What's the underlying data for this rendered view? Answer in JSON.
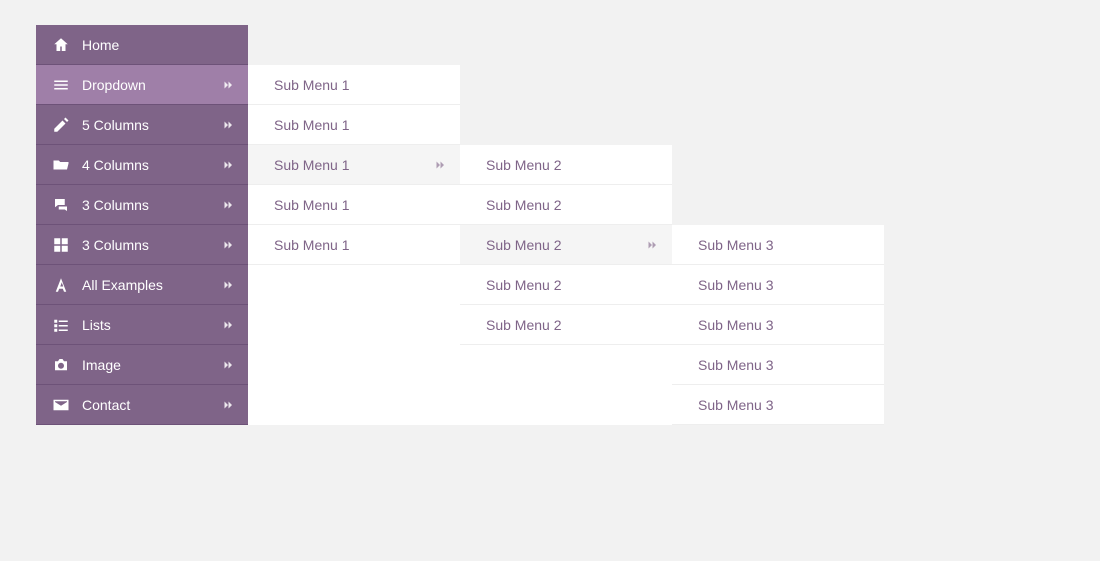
{
  "menu": {
    "items": [
      {
        "label": "Home",
        "icon": "home",
        "arrow": false
      },
      {
        "label": "Dropdown",
        "icon": "bars",
        "arrow": true,
        "active": true
      },
      {
        "label": "5 Columns",
        "icon": "pencil",
        "arrow": true
      },
      {
        "label": "4 Columns",
        "icon": "folder",
        "arrow": true
      },
      {
        "label": "3 Columns",
        "icon": "comments",
        "arrow": true
      },
      {
        "label": "3 Columns",
        "icon": "grid",
        "arrow": true
      },
      {
        "label": "All Examples",
        "icon": "font",
        "arrow": true
      },
      {
        "label": "Lists",
        "icon": "list",
        "arrow": true
      },
      {
        "label": "Image",
        "icon": "camera",
        "arrow": true
      },
      {
        "label": "Contact",
        "icon": "envelope",
        "arrow": true
      }
    ]
  },
  "sub1": {
    "items": [
      {
        "label": "Sub Menu 1",
        "arrow": false,
        "hov": false
      },
      {
        "label": "Sub Menu 1",
        "arrow": false,
        "hov": false
      },
      {
        "label": "Sub Menu 1",
        "arrow": true,
        "hov": true
      },
      {
        "label": "Sub Menu 1",
        "arrow": false,
        "hov": false
      },
      {
        "label": "Sub Menu 1",
        "arrow": false,
        "hov": false
      }
    ]
  },
  "sub2": {
    "items": [
      {
        "label": "Sub Menu 2",
        "arrow": false,
        "hov": false
      },
      {
        "label": "Sub Menu 2",
        "arrow": false,
        "hov": false
      },
      {
        "label": "Sub Menu 2",
        "arrow": true,
        "hov": true
      },
      {
        "label": "Sub Menu 2",
        "arrow": false,
        "hov": false
      },
      {
        "label": "Sub Menu 2",
        "arrow": false,
        "hov": false
      }
    ]
  },
  "sub3": {
    "items": [
      {
        "label": "Sub Menu 3"
      },
      {
        "label": "Sub Menu 3"
      },
      {
        "label": "Sub Menu 3"
      },
      {
        "label": "Sub Menu 3"
      },
      {
        "label": "Sub Menu 3"
      }
    ]
  }
}
